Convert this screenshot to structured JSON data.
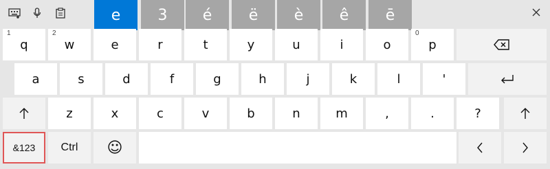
{
  "toolbar": {
    "icons": [
      "keyboard-settings-icon",
      "microphone-icon",
      "clipboard-icon"
    ],
    "close_icon": "close-icon"
  },
  "candidates": [
    "e",
    "3",
    "é",
    "ë",
    "è",
    "ê",
    "ē"
  ],
  "keys": {
    "row1": [
      {
        "label": "q",
        "hint": "1"
      },
      {
        "label": "w",
        "hint": "2"
      },
      {
        "label": "e",
        "hint": ""
      },
      {
        "label": "r",
        "hint": ""
      },
      {
        "label": "t",
        "hint": ""
      },
      {
        "label": "y",
        "hint": ""
      },
      {
        "label": "u",
        "hint": ""
      },
      {
        "label": "i",
        "hint": ""
      },
      {
        "label": "o",
        "hint": ""
      },
      {
        "label": "p",
        "hint": "0"
      }
    ],
    "row2": [
      "a",
      "s",
      "d",
      "f",
      "g",
      "h",
      "j",
      "k",
      "l",
      "'"
    ],
    "row3": [
      "z",
      "x",
      "c",
      "v",
      "b",
      "n",
      "m",
      ",",
      ".",
      "?"
    ],
    "symbols_label": "&123",
    "ctrl_label": "Ctrl",
    "emoji_glyph": "☺",
    "left_glyph": "〈",
    "right_glyph": "〉"
  }
}
